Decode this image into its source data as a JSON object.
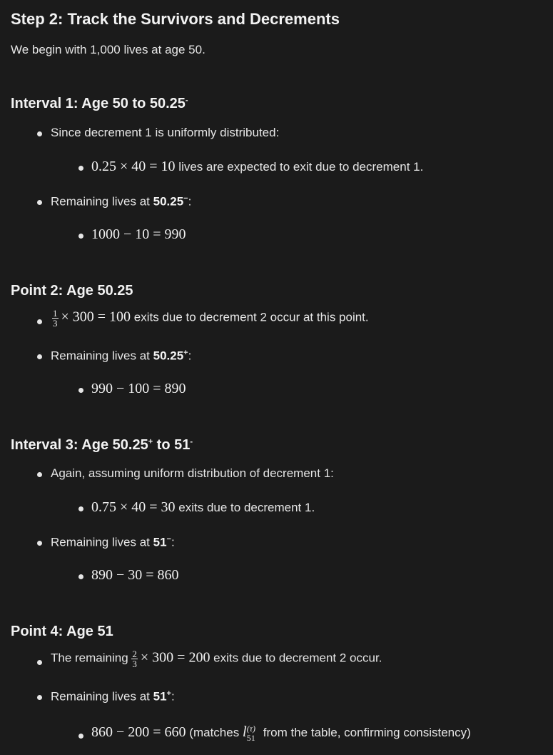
{
  "step_title": "Step 2: Track the Survivors and Decrements",
  "intro": "We begin with 1,000 lives at age 50.",
  "interval1": {
    "heading": "Interval 1: Age 50 to 50.25",
    "heading_sup": "-",
    "b1": "Since decrement 1 is uniformly distributed:",
    "b1_math": "0.25 × 40 = 10",
    "b1_text": " lives are expected to exit due to decrement 1.",
    "b2_prefix": "Remaining lives at ",
    "b2_bold": "50.25",
    "b2_sup": "−",
    "b2_suffix": ":",
    "b2_math": "1000 − 10 = 990"
  },
  "point2": {
    "heading": "Point 2: Age 50.25",
    "frac_num": "1",
    "frac_den": "3",
    "b1_math": "× 300 = 100",
    "b1_text": " exits due to decrement 2 occur at this point.",
    "b2_prefix": "Remaining lives at ",
    "b2_bold": "50.25",
    "b2_sup": "+",
    "b2_suffix": ":",
    "b2_math": "990 − 100 = 890"
  },
  "interval3": {
    "heading_a": "Interval 3: Age 50.25",
    "heading_sup1": "+",
    "heading_b": " to 51",
    "heading_sup2": "-",
    "b1": "Again, assuming uniform distribution of decrement 1:",
    "b1_math": "0.75 × 40 = 30",
    "b1_text": " exits due to decrement 1.",
    "b2_prefix": "Remaining lives at ",
    "b2_bold": "51",
    "b2_sup": "−",
    "b2_suffix": ":",
    "b2_math": "890 − 30 = 860"
  },
  "point4": {
    "heading": "Point 4: Age 51",
    "b1_prefix": "The remaining ",
    "frac_num": "2",
    "frac_den": "3",
    "b1_math": "× 300 = 200",
    "b1_text": " exits due to decrement 2 occur.",
    "b2_prefix": "Remaining lives at ",
    "b2_bold": "51",
    "b2_sup": "+",
    "b2_suffix": ":",
    "b2_math": "860 − 200 = 660",
    "b2_text_a": " (matches ",
    "l_symbol": "l",
    "l_sup": "(τ)",
    "l_sub": "51",
    "b2_text_b": " from the table, confirming consistency)"
  }
}
